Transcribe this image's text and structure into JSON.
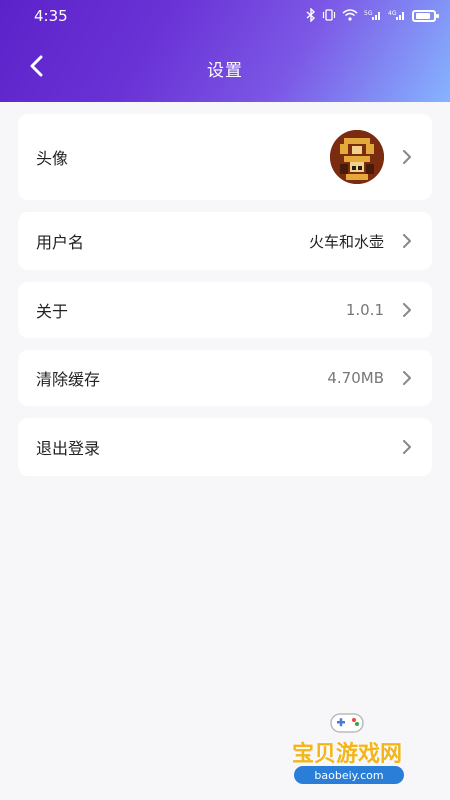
{
  "status_bar": {
    "time": "4:35",
    "icons": [
      "bluetooth-icon",
      "vibrate-icon",
      "wifi-icon",
      "signal-icon",
      "signal-icon",
      "battery-icon"
    ],
    "signal_1": "5G",
    "signal_2": "4G"
  },
  "header": {
    "title": "设置",
    "back_icon": "chevron-left-icon",
    "colors": {
      "start": "#5b22c9",
      "end": "#86b4ff"
    }
  },
  "settings": {
    "avatar_label": "头像",
    "username_label": "用户名",
    "username_value": "火车和水壶",
    "about_label": "关于",
    "about_value": "1.0.1",
    "cache_label": "清除缓存",
    "cache_value": "4.70MB",
    "logout_label": "退出登录"
  },
  "watermark": {
    "text": "宝贝游戏网",
    "url": "baobeiy.com"
  }
}
